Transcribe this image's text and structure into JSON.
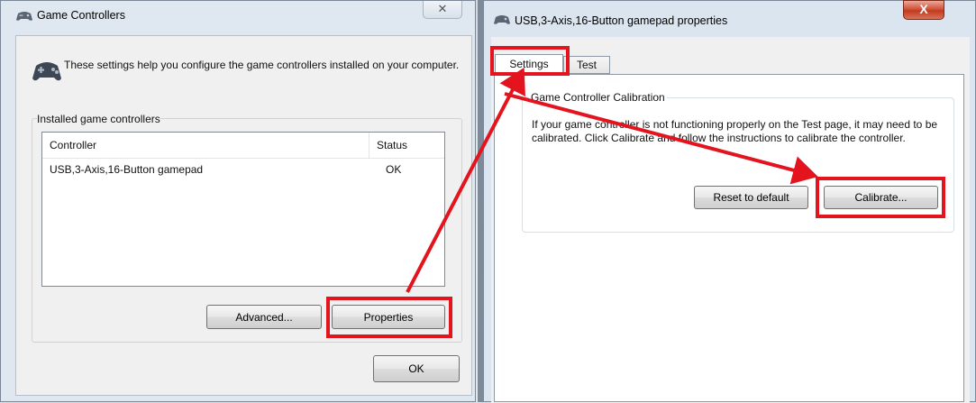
{
  "left_window": {
    "title": "Game Controllers",
    "close_label": "✕",
    "description": "These settings help you configure the game controllers installed on your computer.",
    "group_label": "Installed game controllers",
    "columns": [
      "Controller",
      "Status"
    ],
    "rows": [
      {
        "controller": "USB,3-Axis,16-Button gamepad",
        "status": "OK"
      }
    ],
    "buttons": {
      "advanced": "Advanced...",
      "properties": "Properties",
      "ok": "OK"
    }
  },
  "right_window": {
    "title": "USB,3-Axis,16-Button gamepad properties",
    "close_label": "X",
    "tabs": [
      {
        "label": "Settings",
        "active": true
      },
      {
        "label": "Test",
        "active": false
      }
    ],
    "calibration": {
      "group_label": "Game Controller Calibration",
      "text": "If your game controller is not functioning properly on the Test page, it may need to be calibrated.  Click Calibrate and follow the instructions to calibrate the controller.",
      "reset_label": "Reset to default",
      "calibrate_label": "Calibrate..."
    }
  },
  "annotation": {
    "highlight_color": "#e3141e"
  }
}
